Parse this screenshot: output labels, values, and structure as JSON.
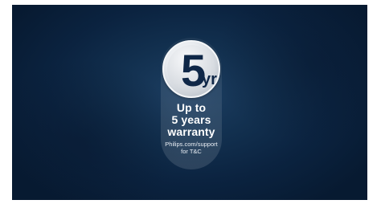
{
  "badge": {
    "number": "5",
    "unit": "yr"
  },
  "headline": {
    "line1": "Up to",
    "line2": "5 years",
    "line3": "warranty"
  },
  "footnote": {
    "line1": "Philips.com/support",
    "line2": "for T&C"
  },
  "colors": {
    "background": "#0b2340",
    "badge_text": "#0f2747",
    "text": "#ffffff"
  }
}
